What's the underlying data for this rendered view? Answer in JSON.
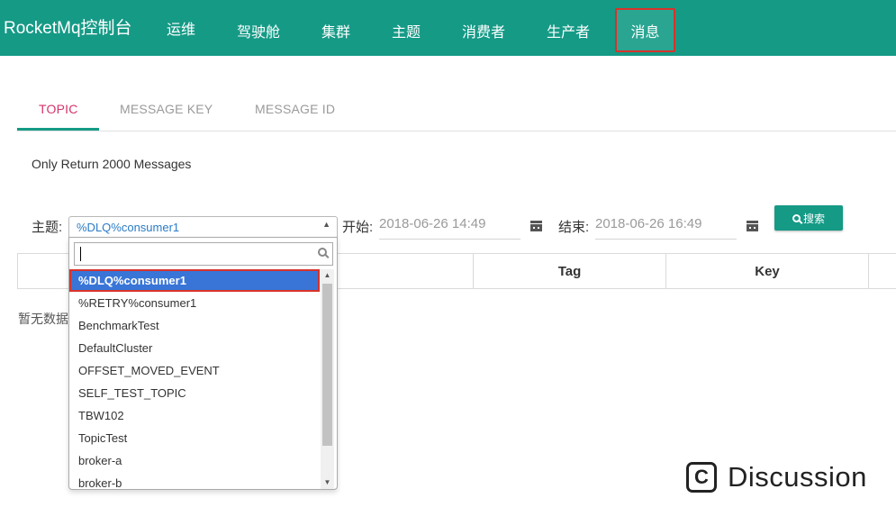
{
  "header": {
    "brand": "RocketMq控制台",
    "nav": [
      "运维",
      "驾驶舱",
      "集群",
      "主题",
      "消费者",
      "生产者",
      "消息"
    ],
    "active_nav": "消息",
    "bg_color": "#159a86",
    "highlight_color": "#d8322b"
  },
  "tabs": {
    "items": [
      "TOPIC",
      "MESSAGE KEY",
      "MESSAGE ID"
    ],
    "active": "TOPIC",
    "active_color": "#d6336c"
  },
  "notice": "Only Return 2000 Messages",
  "search": {
    "topic_label": "主题:",
    "topic_value": "%DLQ%consumer1",
    "start_label": "开始:",
    "start_value": "2018-06-26 14:49",
    "end_label": "结束:",
    "end_value": "2018-06-26 16:49",
    "button_label": "搜索",
    "button_icon": "search-icon"
  },
  "table": {
    "columns": [
      "",
      "Tag",
      "Key",
      ""
    ],
    "empty_text": "暂无数据"
  },
  "dropdown": {
    "search_value": "",
    "options": [
      "%DLQ%consumer1",
      "%RETRY%consumer1",
      "BenchmarkTest",
      "DefaultCluster",
      "OFFSET_MOVED_EVENT",
      "SELF_TEST_TOPIC",
      "TBW102",
      "TopicTest",
      "broker-a",
      "broker-b"
    ],
    "highlighted": "%DLQ%consumer1",
    "highlight_color": "#3875d7"
  },
  "watermark": {
    "icon_letter": "C",
    "text": "Discussion"
  }
}
